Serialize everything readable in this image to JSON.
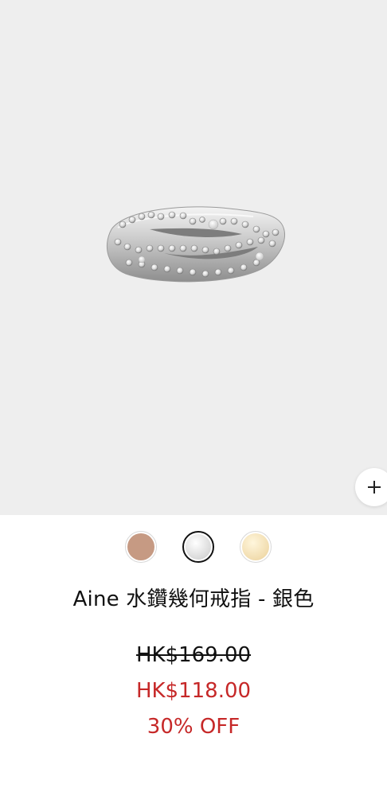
{
  "product": {
    "title": "Aine 水鑽幾何戒指 - 銀色",
    "original_price": "HK$169.00",
    "sale_price": "HK$118.00",
    "discount": "30% OFF",
    "image_icon": "silver-crystal-ring"
  },
  "actions": {
    "add_icon": "plus-icon"
  },
  "swatches": [
    {
      "color_name": "rose-gold",
      "hex": "#c69a83",
      "selected": false
    },
    {
      "color_name": "silver",
      "hex": "#e9e9e9",
      "selected": true
    },
    {
      "color_name": "gold",
      "hex": "#f1dcae",
      "selected": false
    }
  ],
  "colors": {
    "image_background": "#eeeeee",
    "sale_red": "#c62828",
    "text": "#111111"
  }
}
